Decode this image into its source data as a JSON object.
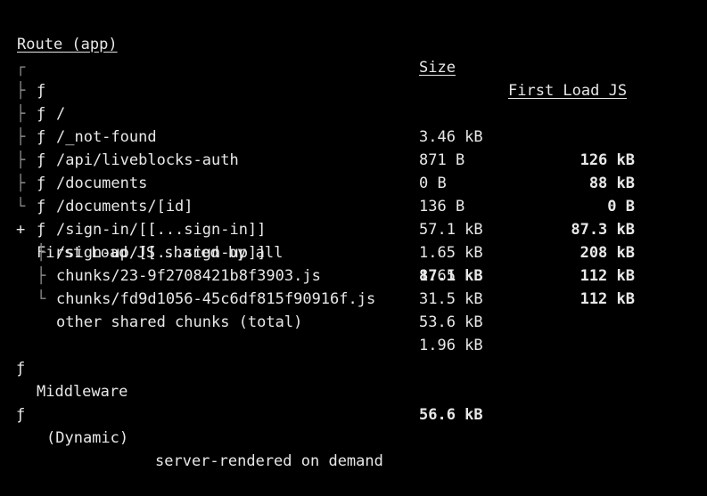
{
  "header": {
    "route": "Route (app)",
    "size": "Size",
    "first_load": "First Load JS"
  },
  "routes": [
    {
      "tree": "┌",
      "sym": "ƒ",
      "path": "/",
      "size": "3.46 kB",
      "first": "126 kB"
    },
    {
      "tree": "├",
      "sym": "ƒ",
      "path": "/_not-found",
      "size": "871 B",
      "first": "88 kB"
    },
    {
      "tree": "├",
      "sym": "ƒ",
      "path": "/api/liveblocks-auth",
      "size": "0 B",
      "first": "0 B"
    },
    {
      "tree": "├",
      "sym": "ƒ",
      "path": "/documents",
      "size": "136 B",
      "first": "87.3 kB"
    },
    {
      "tree": "├",
      "sym": "ƒ",
      "path": "/documents/[id]",
      "size": "57.1 kB",
      "first": "208 kB"
    },
    {
      "tree": "├",
      "sym": "ƒ",
      "path": "/sign-in/[[...sign-in]]",
      "size": "1.65 kB",
      "first": "112 kB"
    },
    {
      "tree": "└",
      "sym": "ƒ",
      "path": "/sign-up/[[...sign-up]]",
      "size": "1.65 kB",
      "first": "112 kB"
    }
  ],
  "shared": {
    "plus": "+",
    "label": "First Load JS shared by all",
    "size": "87.1 kB",
    "chunks": [
      {
        "tree": "├",
        "name": "chunks/23-9f2708421b8f3903.js",
        "size": "31.5 kB"
      },
      {
        "tree": "├",
        "name": "chunks/fd9d1056-45c6df815f90916f.js",
        "size": "53.6 kB"
      },
      {
        "tree": "└",
        "name": "other shared chunks (total)",
        "size": "1.96 kB"
      }
    ]
  },
  "middleware": {
    "sym": "ƒ",
    "label": "Middleware",
    "size": "56.6 kB"
  },
  "legend": {
    "sym": "ƒ",
    "label": "(Dynamic)",
    "desc": "server-rendered on demand"
  }
}
